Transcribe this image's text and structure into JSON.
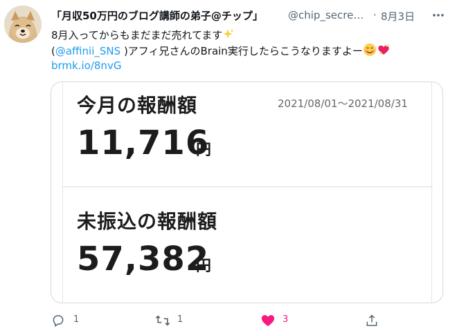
{
  "tweet": {
    "author": {
      "display_name": "「月収50万円のブログ講師の弟子@チップ」",
      "handle": "@chip_secret…",
      "avatar_icon": "shiba-dog-avatar"
    },
    "separator": "·",
    "timestamp": "8月3日",
    "body": {
      "line1": "8月入ってからもまだまだ売れてます",
      "line1_emoji": "sparkles-emoji",
      "line2_open": "(",
      "line2_mention": "@affinii_SNS",
      "line2_text": " )アフィ兄さんのBrain実行したらこうなりますよー",
      "line2_emoji": "smiling-face-and-heart-emoji",
      "line3_link": "brmk.io/8nvG"
    },
    "card": {
      "title_this_month": "今月の報酬額",
      "period": "2021/08/01～2021/08/31",
      "amount_this_month": "11,716",
      "unit": "円",
      "title_unpaid": "未振込の報酬額",
      "amount_unpaid": "57,382"
    },
    "actions": {
      "reply_count": "1",
      "retweet_count": "1",
      "like_count": "3",
      "share_label": ""
    }
  },
  "colors": {
    "accent": "#1d9bf0",
    "like": "#f91880",
    "muted": "#536471",
    "text": "#0f1419"
  }
}
